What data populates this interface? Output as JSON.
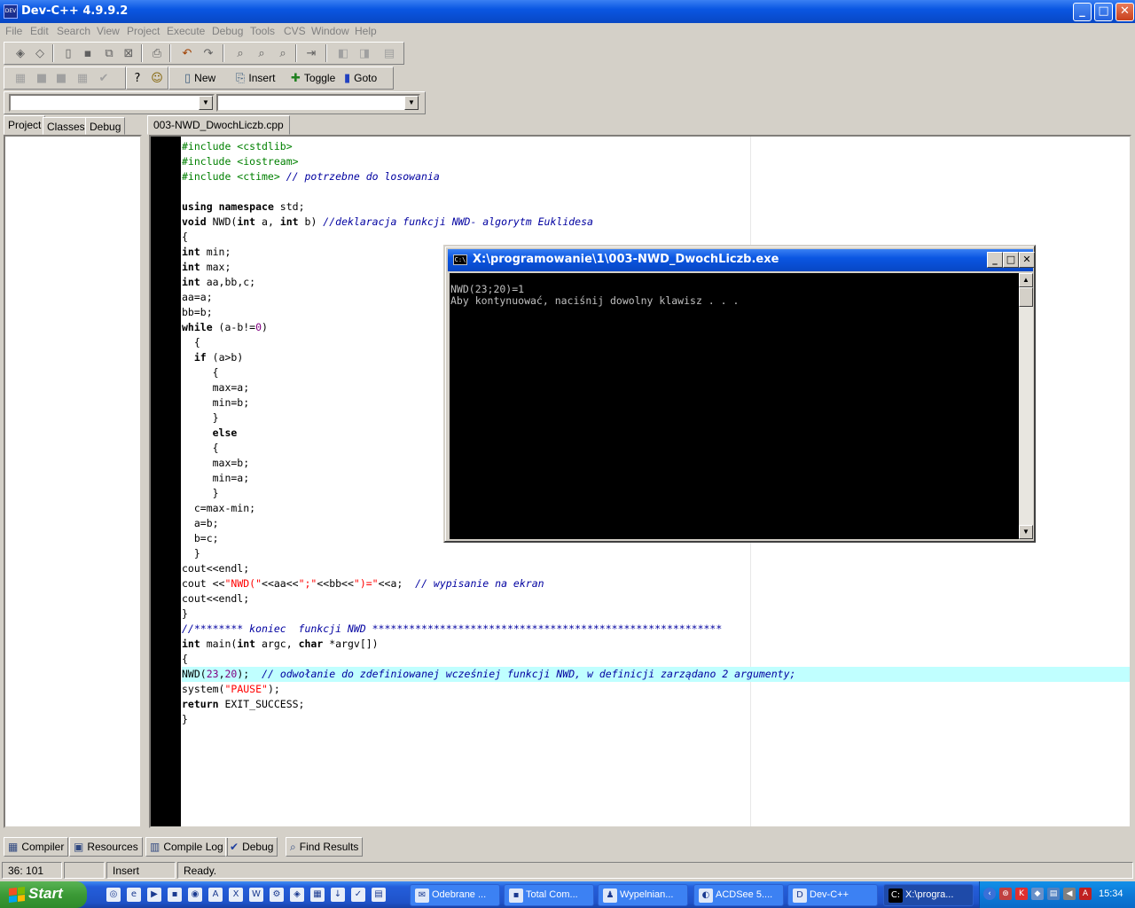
{
  "window": {
    "title": "Dev-C++ 4.9.9.2",
    "icon_label": "DEV",
    "controls": {
      "minimize": "_",
      "maximize": "□",
      "close": "✕"
    }
  },
  "menu": [
    "File",
    "Edit",
    "Search",
    "View",
    "Project",
    "Execute",
    "Debug",
    "Tools",
    "CVS",
    "Window",
    "Help"
  ],
  "toolbar2": {
    "new_label": "New",
    "insert_label": "Insert",
    "toggle_label": "Toggle",
    "goto_label": "Goto"
  },
  "left_tabs": [
    "Project",
    "Classes",
    "Debug"
  ],
  "editor": {
    "file_tab": "003-NWD_DwochLiczb.cpp",
    "highlighted_line": 36
  },
  "code_lines": [
    "#include <cstdlib>",
    "#include <iostream>",
    "#include <ctime> // potrzebne do losowania",
    "",
    "using namespace std;",
    "void NWD(int a, int b) //deklaracja funkcji NWD- algorytm Euklidesa",
    "{",
    "int min;",
    "int max;",
    "int aa,bb,c;",
    "aa=a;",
    "bb=b;",
    "while (a-b!=0)",
    "  {",
    "  if (a>b)",
    "     {",
    "     max=a;",
    "     min=b;",
    "     }",
    "     else",
    "     {",
    "     max=b;",
    "     min=a;",
    "     }",
    "  c=max-min;",
    "  a=b;",
    "  b=c;",
    "  }",
    "cout<<endl;",
    "cout <<\"NWD(\"<<aa<<\";\"<<bb<<\")=\"<<a;  // wypisanie na ekran",
    "cout<<endl;",
    "}",
    "//******** koniec  funkcji NWD *********************************************************",
    "int main(int argc, char *argv[])",
    "{",
    "NWD(23,20);  // odwołanie do zdefiniowanej wcześniej funkcji NWD, w definicji zarządano 2 argumenty;",
    "system(\"PAUSE\");",
    "return EXIT_SUCCESS;",
    "}"
  ],
  "console": {
    "title": "X:\\programowanie\\1\\003-NWD_DwochLiczb.exe",
    "icon_label": "C:\\",
    "lines": [
      "NWD(23;20)=1",
      "Aby kontynuować, naciśnij dowolny klawisz . . ."
    ]
  },
  "bottom_tabs": [
    {
      "label": "Compiler",
      "icon": "grid-icon"
    },
    {
      "label": "Resources",
      "icon": "resources-icon"
    },
    {
      "label": "Compile Log",
      "icon": "chart-icon"
    },
    {
      "label": "Debug",
      "icon": "check-icon"
    },
    {
      "label": "Find Results",
      "icon": "find-icon"
    }
  ],
  "status": {
    "position": "36: 101",
    "modified": "",
    "mode": "Insert",
    "message": "Ready."
  },
  "taskbar": {
    "start_label": "Start",
    "tasks": [
      {
        "label": "Odebrane ...",
        "active": false
      },
      {
        "label": "Total Com...",
        "active": false
      },
      {
        "label": "Wypelnian...",
        "active": false
      },
      {
        "label": "ACDSee 5....",
        "active": false
      },
      {
        "label": "Dev-C++",
        "active": false
      },
      {
        "label": "X:\\progra...",
        "active": true
      }
    ],
    "clock": "15:34"
  },
  "colors": {
    "keyword": "#000000",
    "preprocessor": "#008000",
    "comment": "#0000a0",
    "string": "#ff0000",
    "number": "#800080",
    "highlight_line": "#c0ffff"
  }
}
